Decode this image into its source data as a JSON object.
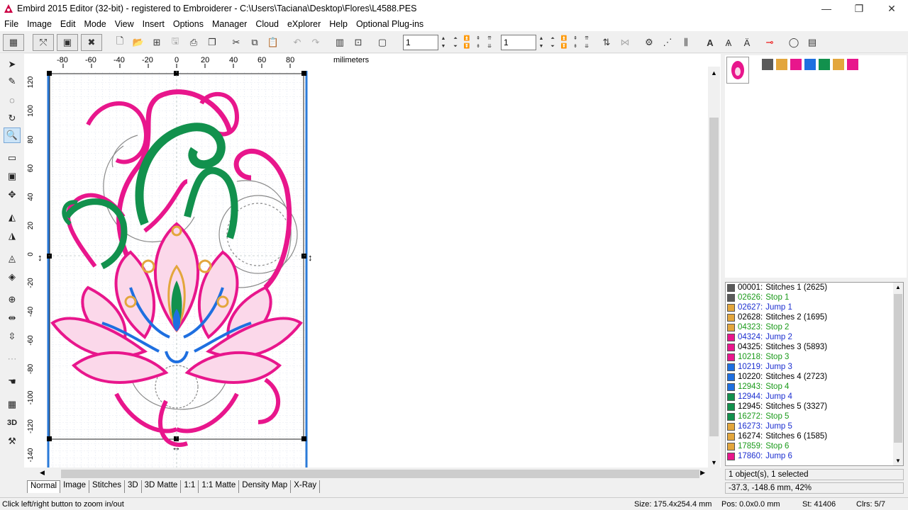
{
  "window": {
    "title": "Embird 2015 Editor (32-bit) - registered to Embroiderer - C:\\Users\\Taciana\\Desktop\\Flores\\L4588.PES",
    "minimize": "—",
    "maximize": "❐",
    "close": "✕"
  },
  "menu": [
    "File",
    "Image",
    "Edit",
    "Mode",
    "View",
    "Insert",
    "Options",
    "Manager",
    "Cloud",
    "eXplorer",
    "Help",
    "Optional Plug-ins"
  ],
  "toolbar": {
    "spin1_value": "1",
    "spin2_value": "1"
  },
  "ruler": {
    "unit": "milimeters",
    "x_ticks": [
      "-80",
      "-60",
      "-40",
      "-20",
      "0",
      "20",
      "40",
      "60",
      "80"
    ],
    "y_ticks": [
      "120",
      "100",
      "80",
      "60",
      "40",
      "20",
      "0",
      "-20",
      "-40",
      "-60",
      "-80",
      "-100",
      "-120",
      "-140"
    ]
  },
  "tabs": [
    "Normal",
    "Image",
    "Stitches",
    "3D",
    "3D Matte",
    "1:1",
    "1:1 Matte",
    "Density Map",
    "X-Ray"
  ],
  "active_tab": "Normal",
  "palette": [
    "#5a5a5a",
    "#e3a63c",
    "#e8168c",
    "#1e6fe0",
    "#12914d",
    "#e3a63c",
    "#e8168c"
  ],
  "stitch_list": [
    {
      "num": "00001:",
      "label": "Stitches 1 (2625)",
      "color": "#5a5a5a",
      "kind": "stitch"
    },
    {
      "num": "02626:",
      "label": "Stop 1",
      "color": "#5a5a5a",
      "kind": "stop"
    },
    {
      "num": "02627:",
      "label": "Jump 1",
      "color": "#e3a63c",
      "kind": "jump"
    },
    {
      "num": "02628:",
      "label": "Stitches 2 (1695)",
      "color": "#e3a63c",
      "kind": "stitch"
    },
    {
      "num": "04323:",
      "label": "Stop 2",
      "color": "#e3a63c",
      "kind": "stop"
    },
    {
      "num": "04324:",
      "label": "Jump 2",
      "color": "#e8168c",
      "kind": "jump"
    },
    {
      "num": "04325:",
      "label": "Stitches 3 (5893)",
      "color": "#e8168c",
      "kind": "stitch"
    },
    {
      "num": "10218:",
      "label": "Stop 3",
      "color": "#e8168c",
      "kind": "stop"
    },
    {
      "num": "10219:",
      "label": "Jump 3",
      "color": "#1e6fe0",
      "kind": "jump"
    },
    {
      "num": "10220:",
      "label": "Stitches 4 (2723)",
      "color": "#1e6fe0",
      "kind": "stitch"
    },
    {
      "num": "12943:",
      "label": "Stop 4",
      "color": "#1e6fe0",
      "kind": "stop"
    },
    {
      "num": "12944:",
      "label": "Jump 4",
      "color": "#12914d",
      "kind": "jump"
    },
    {
      "num": "12945:",
      "label": "Stitches 5 (3327)",
      "color": "#12914d",
      "kind": "stitch"
    },
    {
      "num": "16272:",
      "label": "Stop 5",
      "color": "#12914d",
      "kind": "stop"
    },
    {
      "num": "16273:",
      "label": "Jump 5",
      "color": "#e3a63c",
      "kind": "jump"
    },
    {
      "num": "16274:",
      "label": "Stitches 6 (1585)",
      "color": "#e3a63c",
      "kind": "stitch"
    },
    {
      "num": "17859:",
      "label": "Stop 6",
      "color": "#e3a63c",
      "kind": "stop"
    },
    {
      "num": "17860:",
      "label": "Jump 6",
      "color": "#e8168c",
      "kind": "jump"
    }
  ],
  "selection_info": "1 object(s), 1 selected",
  "cursor_info": "-37.3, -148.6 mm, 42%",
  "status": {
    "hint": "Click left/right button to zoom in/out",
    "size": "Size: 175.4x254.4 mm",
    "pos": "Pos: 0.0x0.0 mm",
    "stitches": "St: 41406",
    "colors": "Clrs: 5/7"
  }
}
